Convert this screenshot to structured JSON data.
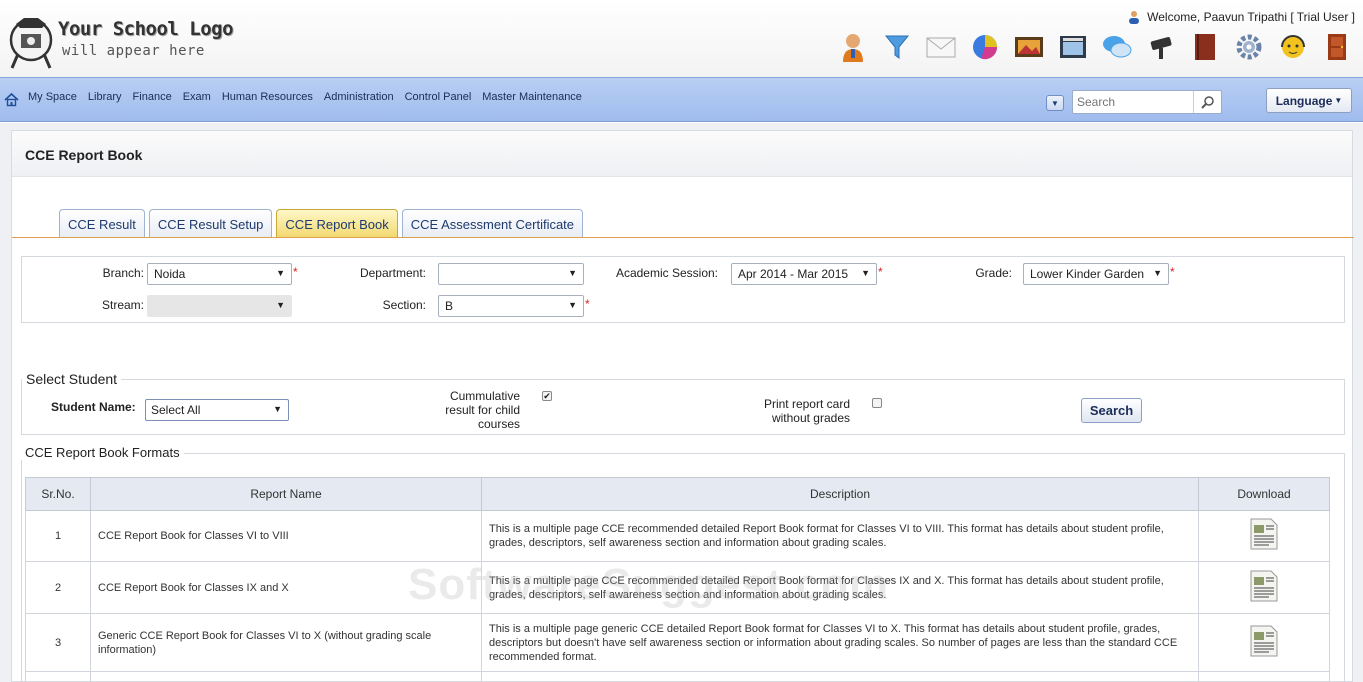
{
  "header": {
    "logo_line1": "Your School Logo",
    "logo_line2": "will appear here",
    "welcome": "Welcome, Paavun Tripathi [ Trial User ]",
    "toolbar_icons": [
      "user-icon",
      "filter-icon",
      "mail-icon",
      "pie-chart-icon",
      "photo-icon",
      "calendar-icon",
      "chat-icon",
      "cctv-icon",
      "book-icon",
      "settings-icon",
      "support-icon",
      "exit-door-icon"
    ]
  },
  "nav": {
    "items": [
      "My Space",
      "Library",
      "Finance",
      "Exam",
      "Human Resources",
      "Administration",
      "Control Panel",
      "Master Maintenance"
    ],
    "search_placeholder": "Search",
    "language": "Language"
  },
  "page": {
    "title": "CCE Report Book",
    "tabs": [
      {
        "label": "CCE Result",
        "active": false
      },
      {
        "label": "CCE Result Setup",
        "active": false
      },
      {
        "label": "CCE Report Book",
        "active": true
      },
      {
        "label": "CCE Assessment Certificate",
        "active": false
      }
    ]
  },
  "filters": {
    "branch_label": "Branch:",
    "branch_value": "Noida",
    "department_label": "Department:",
    "department_value": "",
    "session_label": "Academic Session:",
    "session_value": "Apr 2014 - Mar 2015",
    "grade_label": "Grade:",
    "grade_value": "Lower Kinder Garden",
    "stream_label": "Stream:",
    "stream_value": "",
    "section_label": "Section:",
    "section_value": "B"
  },
  "select_student": {
    "legend": "Select Student",
    "student_label": "Student Name:",
    "student_value": "Select All",
    "cumulative_line1": "Cummulative",
    "cumulative_line2": "result for child",
    "cumulative_line3": "courses",
    "cumulative_checked": true,
    "print_line1": "Print report card",
    "print_line2": "without grades",
    "print_checked": false,
    "search_button": "Search"
  },
  "formats": {
    "legend": "CCE Report Book Formats",
    "columns": [
      "Sr.No.",
      "Report Name",
      "Description",
      "Download"
    ],
    "rows": [
      {
        "sr": "1",
        "name": "CCE Report Book for Classes VI to VIII",
        "desc": "This is a multiple page CCE recommended detailed Report Book format for Classes VI to VIII. This format has details about student profile, grades, descriptors, self awareness section and information about grading scales."
      },
      {
        "sr": "2",
        "name": "CCE Report Book for Classes IX and X",
        "desc": "This is a multiple page CCE recommended detailed Report Book format for Classes IX and X. This format has details about student profile, grades, descriptors, self awareness section and information about grading scales."
      },
      {
        "sr": "3",
        "name": "Generic CCE Report Book for Classes VI to X (without grading scale information)",
        "desc": "This is a multiple page generic CCE detailed Report Book format for Classes VI to X. This format has details about student profile, grades, descriptors but doesn't have self awareness section or information about grading scales. So number of pages are less than the standard CCE recommended format."
      }
    ]
  },
  "watermark": "SoftwareSuggest.com"
}
